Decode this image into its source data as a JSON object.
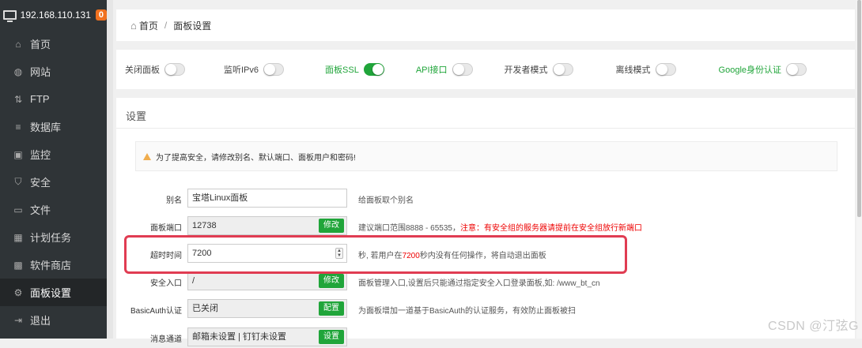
{
  "sidebar": {
    "server_ip": "192.168.110.131",
    "badge": "0",
    "items": [
      {
        "label": "首页",
        "icon": "home-icon",
        "glyph": "⌂"
      },
      {
        "label": "网站",
        "icon": "globe-icon",
        "glyph": "◍"
      },
      {
        "label": "FTP",
        "icon": "ftp-icon",
        "glyph": "⇅"
      },
      {
        "label": "数据库",
        "icon": "database-icon",
        "glyph": "≡"
      },
      {
        "label": "监控",
        "icon": "monitor-icon",
        "glyph": "▣"
      },
      {
        "label": "安全",
        "icon": "shield-icon",
        "glyph": "⛉"
      },
      {
        "label": "文件",
        "icon": "folder-icon",
        "glyph": "▭"
      },
      {
        "label": "计划任务",
        "icon": "calendar-icon",
        "glyph": "▦"
      },
      {
        "label": "软件商店",
        "icon": "apps-icon",
        "glyph": "▩"
      },
      {
        "label": "面板设置",
        "icon": "gear-icon",
        "glyph": "⚙",
        "active": true
      },
      {
        "label": "退出",
        "icon": "logout-icon",
        "glyph": "⇥"
      }
    ]
  },
  "breadcrumb": {
    "home": "首页",
    "separator": "/",
    "current": "面板设置"
  },
  "toggles": [
    {
      "label": "关闭面板",
      "on": false,
      "green": false
    },
    {
      "label": "监听IPv6",
      "on": false,
      "green": false
    },
    {
      "label": "面板SSL",
      "on": true,
      "green": true
    },
    {
      "label": "API接口",
      "on": false,
      "green": true
    },
    {
      "label": "开发者模式",
      "on": false,
      "green": false
    },
    {
      "label": "离线模式",
      "on": false,
      "green": false
    },
    {
      "label": "Google身份认证",
      "on": false,
      "green": true
    }
  ],
  "settings": {
    "title": "设置",
    "warning": "为了提高安全，请修改别名、默认端口、面板用户和密码!",
    "alias": {
      "label": "别名",
      "value": "宝塔Linux面板",
      "help": "给面板取个别名"
    },
    "port": {
      "label": "面板端口",
      "value": "12738",
      "button": "修改",
      "help": "建议端口范围8888 - 65535，",
      "help_red": "注意：有安全组的服务器请提前在安全组放行新端口"
    },
    "timeout": {
      "label": "超时时间",
      "value": "7200",
      "help_a": "秒, 若用户在",
      "help_num": "7200",
      "help_b": "秒内没有任何操作，将自动退出面板"
    },
    "entry": {
      "label": "安全入口",
      "value": "/",
      "button": "修改",
      "help": "面板管理入口,设置后只能通过指定安全入口登录面板,如: /www_bt_cn"
    },
    "basicauth": {
      "label": "BasicAuth认证",
      "value": "已关闭",
      "button": "配置",
      "help": "为面板增加一道基于BasicAuth的认证服务，有效防止面板被扫"
    },
    "notify": {
      "label": "消息通道",
      "value": "邮箱未设置 | 钉钉未设置",
      "button": "设置"
    }
  },
  "watermark": "CSDN @汀弦G",
  "colors": {
    "accent": "#20a53a",
    "sidebar_bg": "#2f3437",
    "highlight": "#e03c52",
    "warning": "#f0ad4e"
  }
}
